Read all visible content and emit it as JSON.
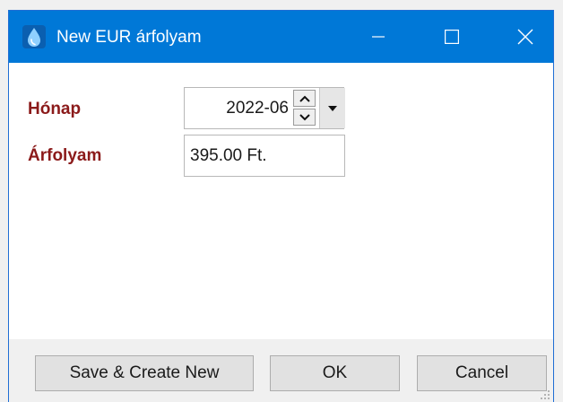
{
  "window": {
    "title": "New EUR árfolyam",
    "icon": "water-drop-icon",
    "controls": [
      "minimize-icon",
      "maximize-icon",
      "close-icon"
    ],
    "accent": "#0078d7"
  },
  "form": {
    "month_label": "Hónap",
    "month_value": "2022-06",
    "rate_label": "Árfolyam",
    "rate_value": "395.00 Ft.",
    "label_color": "#8b1a1a"
  },
  "footer": {
    "save_new_label": "Save & Create New",
    "ok_label": "OK",
    "cancel_label": "Cancel"
  }
}
